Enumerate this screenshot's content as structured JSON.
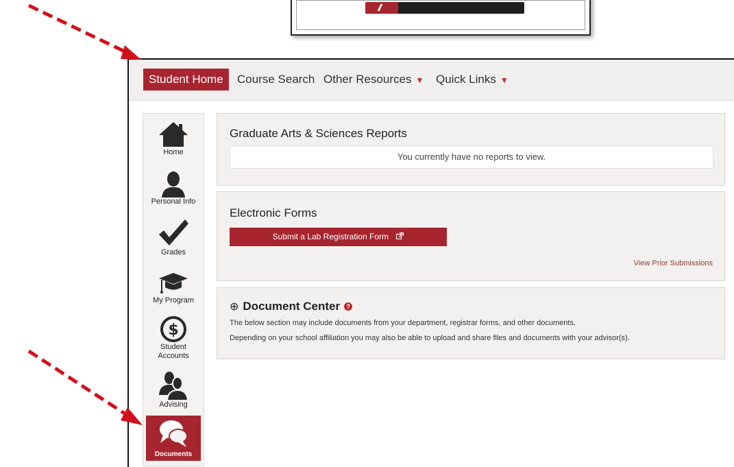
{
  "nav": {
    "items": [
      {
        "label": "Student Home",
        "active": true
      },
      {
        "label": "Course Search",
        "active": false
      },
      {
        "label": "Other Resources",
        "has_caret": true
      },
      {
        "label": "Quick Links",
        "has_caret": true
      }
    ],
    "caret": "▼"
  },
  "sidebar": {
    "items": [
      {
        "label": "Home",
        "icon": "home-icon"
      },
      {
        "label": "Personal Info",
        "icon": "person-icon"
      },
      {
        "label": "Grades",
        "icon": "checkmark-icon"
      },
      {
        "label": "My Program",
        "icon": "graduation-cap-icon"
      },
      {
        "label": "Student Accounts",
        "icon": "dollar-icon"
      },
      {
        "label": "Advising",
        "icon": "people-icon"
      },
      {
        "label": "Documents",
        "icon": "chat-bubbles-icon",
        "active": true
      }
    ]
  },
  "reports": {
    "title": "Graduate Arts & Sciences Reports",
    "empty_message": "You currently have no reports to view."
  },
  "forms": {
    "title": "Electronic Forms",
    "submit_label": "Submit a Lab Registration Form",
    "view_prior": "View Prior Submissions"
  },
  "documents": {
    "title": "Document Center",
    "expand_glyph": "⊕",
    "help_glyph": "?",
    "line1": "The below section may include documents from your department, registrar forms, and other documents.",
    "line2": "Depending on your school affiliation you may also be able to upload and share files and documents with your advisor(s)."
  },
  "colors": {
    "accent": "#a7252f",
    "annotation_arrow": "#d0101a",
    "nav_background": "#f0efed"
  }
}
